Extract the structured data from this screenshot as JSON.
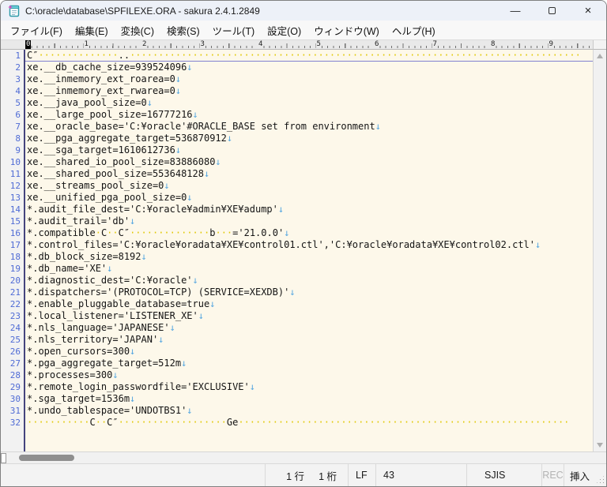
{
  "window": {
    "title": "C:\\oracle\\database\\SPFILEXE.ORA - sakura 2.4.1.2849",
    "controls": {
      "minimize": "—",
      "maximize": "",
      "close": "×"
    }
  },
  "menu": {
    "items": [
      "ファイル(F)",
      "編集(E)",
      "変換(C)",
      "検索(S)",
      "ツール(T)",
      "設定(O)",
      "ウィンドウ(W)",
      "ヘルプ(H)"
    ]
  },
  "ruler": {
    "numbers": [
      "0",
      "1",
      "2",
      "3",
      "4",
      "5",
      "6",
      "7",
      "8",
      "9"
    ],
    "active_index": 0
  },
  "editor": {
    "eol_mark": "↓",
    "whitespace_dot_char": "·",
    "lines": [
      {
        "num": 1,
        "segs": [
          {
            "k": "t",
            "v": "C″"
          },
          {
            "k": "d",
            "n": 14
          },
          {
            "k": "t",
            "v": ".."
          },
          {
            "k": "d",
            "n": 79
          }
        ]
      },
      {
        "num": 2,
        "segs": [
          {
            "k": "t",
            "v": "xe.__db_cache_size=939524096"
          },
          {
            "k": "e"
          }
        ]
      },
      {
        "num": 3,
        "segs": [
          {
            "k": "t",
            "v": "xe.__inmemory_ext_roarea=0"
          },
          {
            "k": "e"
          }
        ]
      },
      {
        "num": 4,
        "segs": [
          {
            "k": "t",
            "v": "xe.__inmemory_ext_rwarea=0"
          },
          {
            "k": "e"
          }
        ]
      },
      {
        "num": 5,
        "segs": [
          {
            "k": "t",
            "v": "xe.__java_pool_size=0"
          },
          {
            "k": "e"
          }
        ]
      },
      {
        "num": 6,
        "segs": [
          {
            "k": "t",
            "v": "xe.__large_pool_size=16777216"
          },
          {
            "k": "e"
          }
        ]
      },
      {
        "num": 7,
        "segs": [
          {
            "k": "t",
            "v": "xe.__oracle_base='C:¥oracle'#ORACLE_BASE set from environment"
          },
          {
            "k": "e"
          }
        ]
      },
      {
        "num": 8,
        "segs": [
          {
            "k": "t",
            "v": "xe.__pga_aggregate_target=536870912"
          },
          {
            "k": "e"
          }
        ]
      },
      {
        "num": 9,
        "segs": [
          {
            "k": "t",
            "v": "xe.__sga_target=1610612736"
          },
          {
            "k": "e"
          }
        ]
      },
      {
        "num": 10,
        "segs": [
          {
            "k": "t",
            "v": "xe.__shared_io_pool_size=83886080"
          },
          {
            "k": "e"
          }
        ]
      },
      {
        "num": 11,
        "segs": [
          {
            "k": "t",
            "v": "xe.__shared_pool_size=553648128"
          },
          {
            "k": "e"
          }
        ]
      },
      {
        "num": 12,
        "segs": [
          {
            "k": "t",
            "v": "xe.__streams_pool_size=0"
          },
          {
            "k": "e"
          }
        ]
      },
      {
        "num": 13,
        "segs": [
          {
            "k": "t",
            "v": "xe.__unified_pga_pool_size=0"
          },
          {
            "k": "e"
          }
        ]
      },
      {
        "num": 14,
        "segs": [
          {
            "k": "t",
            "v": "*.audit_file_dest='C:¥oracle¥admin¥XE¥adump'"
          },
          {
            "k": "e"
          }
        ]
      },
      {
        "num": 15,
        "segs": [
          {
            "k": "t",
            "v": "*.audit_trail='db'"
          },
          {
            "k": "e"
          }
        ]
      },
      {
        "num": 16,
        "segs": [
          {
            "k": "t",
            "v": "*.compatible"
          },
          {
            "k": "d",
            "n": 1
          },
          {
            "k": "t",
            "v": "C"
          },
          {
            "k": "d",
            "n": 2
          },
          {
            "k": "t",
            "v": "C″"
          },
          {
            "k": "d",
            "n": 14
          },
          {
            "k": "t",
            "v": "b"
          },
          {
            "k": "d",
            "n": 3
          },
          {
            "k": "t",
            "v": "='21.0.0'"
          },
          {
            "k": "e"
          }
        ]
      },
      {
        "num": 17,
        "segs": [
          {
            "k": "t",
            "v": "*.control_files='C:¥oracle¥oradata¥XE¥control01.ctl','C:¥oracle¥oradata¥XE¥control02.ctl'"
          },
          {
            "k": "e"
          }
        ]
      },
      {
        "num": 18,
        "segs": [
          {
            "k": "t",
            "v": "*.db_block_size=8192"
          },
          {
            "k": "e"
          }
        ]
      },
      {
        "num": 19,
        "segs": [
          {
            "k": "t",
            "v": "*.db_name='XE'"
          },
          {
            "k": "e"
          }
        ]
      },
      {
        "num": 20,
        "segs": [
          {
            "k": "t",
            "v": "*.diagnostic_dest='C:¥oracle'"
          },
          {
            "k": "e"
          }
        ]
      },
      {
        "num": 21,
        "segs": [
          {
            "k": "t",
            "v": "*.dispatchers='(PROTOCOL=TCP) (SERVICE=XEXDB)'"
          },
          {
            "k": "e"
          }
        ]
      },
      {
        "num": 22,
        "segs": [
          {
            "k": "t",
            "v": "*.enable_pluggable_database=true"
          },
          {
            "k": "e"
          }
        ]
      },
      {
        "num": 23,
        "segs": [
          {
            "k": "t",
            "v": "*.local_listener='LISTENER_XE'"
          },
          {
            "k": "e"
          }
        ]
      },
      {
        "num": 24,
        "segs": [
          {
            "k": "t",
            "v": "*.nls_language='JAPANESE'"
          },
          {
            "k": "e"
          }
        ]
      },
      {
        "num": 25,
        "segs": [
          {
            "k": "t",
            "v": "*.nls_territory='JAPAN'"
          },
          {
            "k": "e"
          }
        ]
      },
      {
        "num": 26,
        "segs": [
          {
            "k": "t",
            "v": "*.open_cursors=300"
          },
          {
            "k": "e"
          }
        ]
      },
      {
        "num": 27,
        "segs": [
          {
            "k": "t",
            "v": "*.pga_aggregate_target=512m"
          },
          {
            "k": "e"
          }
        ]
      },
      {
        "num": 28,
        "segs": [
          {
            "k": "t",
            "v": "*.processes=300"
          },
          {
            "k": "e"
          }
        ]
      },
      {
        "num": 29,
        "segs": [
          {
            "k": "t",
            "v": "*.remote_login_passwordfile='EXCLUSIVE'"
          },
          {
            "k": "e"
          }
        ]
      },
      {
        "num": 30,
        "segs": [
          {
            "k": "t",
            "v": "*.sga_target=1536m"
          },
          {
            "k": "e"
          }
        ]
      },
      {
        "num": 31,
        "segs": [
          {
            "k": "t",
            "v": "*.undo_tablespace='UNDOTBS1'"
          },
          {
            "k": "e"
          }
        ]
      },
      {
        "num": 32,
        "segs": [
          {
            "k": "d",
            "n": 11
          },
          {
            "k": "t",
            "v": "C"
          },
          {
            "k": "d",
            "n": 2
          },
          {
            "k": "t",
            "v": "C″"
          },
          {
            "k": "d",
            "n": 19
          },
          {
            "k": "t",
            "v": "Ge"
          },
          {
            "k": "d",
            "n": 58
          }
        ]
      }
    ]
  },
  "status_bar": {
    "message": "",
    "line": "1 行",
    "column": "1 桁",
    "eol_type": "LF",
    "char_code": "43",
    "encoding": "SJIS",
    "rec": "REC",
    "input_mode": "挿入"
  },
  "colors": {
    "editor_bg": "#fdf8ea",
    "line_number": "#4f6bd5",
    "gutter_separator": "#44447e",
    "eol_mark": "#56a7e0",
    "whitespace_dot": "#e0c800",
    "cursor_line_underline": "#8080d0",
    "titlebar_bg": "#edf1f8"
  }
}
